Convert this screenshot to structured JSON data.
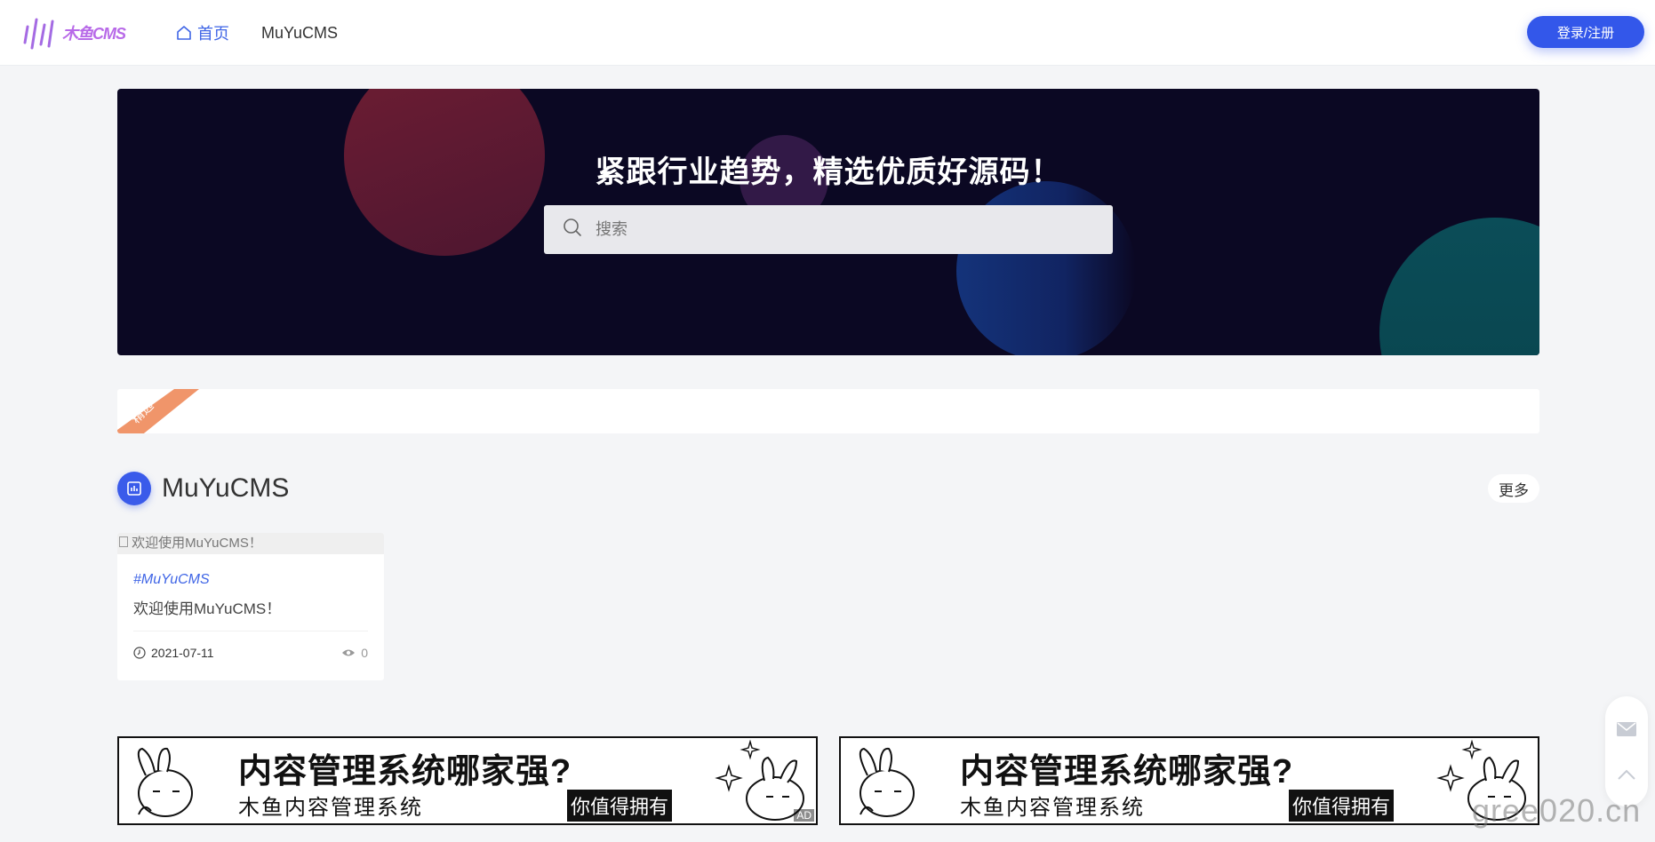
{
  "header": {
    "logo_text": "木鱼CMS",
    "nav": [
      {
        "label": "首页",
        "icon": "home-icon",
        "active": true
      },
      {
        "label": "MuYuCMS",
        "active": false
      }
    ],
    "login_label": "登录/注册"
  },
  "banner": {
    "title": "紧跟行业趋势，精选优质好源码！",
    "search_placeholder": "搜索"
  },
  "featured": {
    "ribbon_label": "精选"
  },
  "section": {
    "title": "MuYuCMS",
    "more_label": "更多",
    "cards": [
      {
        "image_alt": "欢迎使用MuYuCMS！",
        "tag": "#MuYuCMS",
        "title": "欢迎使用MuYuCMS！",
        "date": "2021-07-11",
        "views": "0"
      }
    ]
  },
  "ads": [
    {
      "headline": "内容管理系统哪家强?",
      "sub": "木鱼内容管理系统",
      "cta": "你值得拥有",
      "mark": "AD"
    },
    {
      "headline": "内容管理系统哪家强?",
      "sub": "木鱼内容管理系统",
      "cta": "你值得拥有",
      "mark": ""
    }
  ],
  "float_bar": {
    "icons": [
      "mail-icon",
      "arrow-up-icon"
    ]
  },
  "watermark": "gree020.cn",
  "colors": {
    "accent": "#3357ea",
    "link": "#3f65e6",
    "banner_bg": "#0b0823",
    "ribbon": "#f0956a"
  }
}
